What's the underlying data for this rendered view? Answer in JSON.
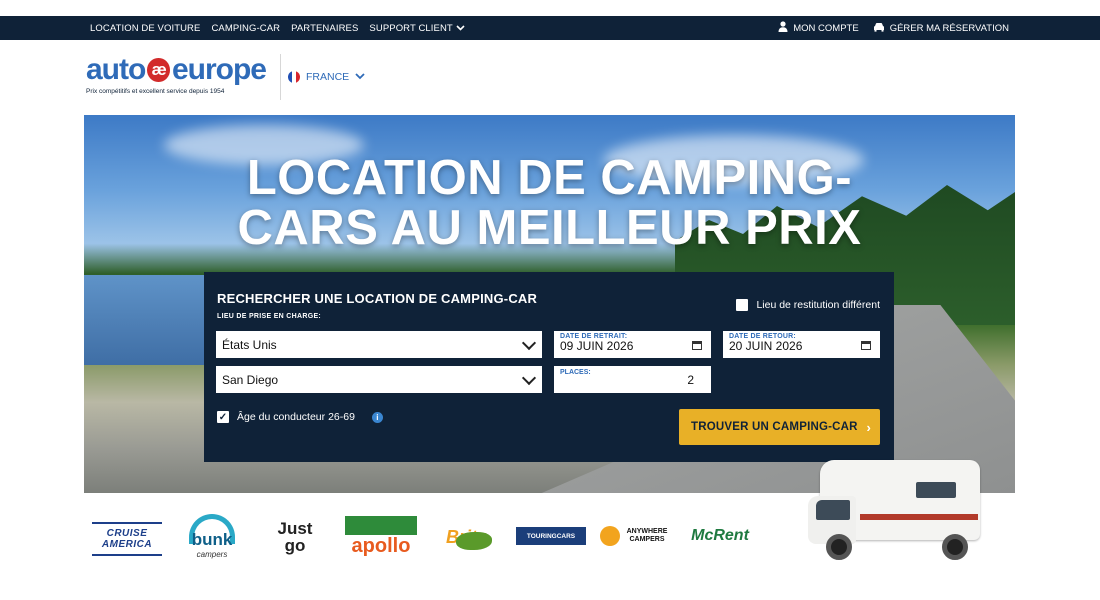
{
  "topbar": {
    "nav": [
      "LOCATION DE VOITURE",
      "CAMPING-CAR",
      "PARTENAIRES",
      "SUPPORT CLIENT"
    ],
    "account": "MON COMPTE",
    "manage": "GÉRER MA RÉSERVATION"
  },
  "header": {
    "logo_text_left": "auto",
    "logo_ae": "æ",
    "logo_text_right": "europe",
    "logo_tagline": "Prix compétitifs et excellent service depuis 1954",
    "language": "FRANCE"
  },
  "hero": {
    "title_line1": "LOCATION DE CAMPING-",
    "title_line2": "CARS AU MEILLEUR PRIX"
  },
  "search": {
    "title": "RECHERCHER UNE LOCATION DE CAMPING-CAR",
    "pickup_label": "LIEU DE PRISE EN CHARGE:",
    "different_return": "Lieu de restitution différent",
    "country": "États Unis",
    "city": "San Diego",
    "pickup_date_label": "DATE DE RETRAIT:",
    "pickup_date": "09 JUIN 2026",
    "return_date_label": "DATE DE RETOUR:",
    "return_date": "20 JUIN 2026",
    "places_label": "PLACES:",
    "places": "2",
    "driver_age": "Âge du conducteur 26-69",
    "cta": "TROUVER UN CAMPING-CAR"
  },
  "partners": {
    "cruise": "CRUISE AMERICA",
    "bunk": "bunk",
    "bunk_sub": "campers",
    "just": "Just",
    "go": "go",
    "apollo": "apollo",
    "britz": "Britz",
    "touring": "TOURINGCARS",
    "anywhere": "ANYWHERE CAMPERS",
    "mcrent": "McRent"
  },
  "colors": {
    "navy": "#0f2238",
    "accent_blue": "#2f6bb8",
    "cta_yellow": "#e8b027"
  }
}
